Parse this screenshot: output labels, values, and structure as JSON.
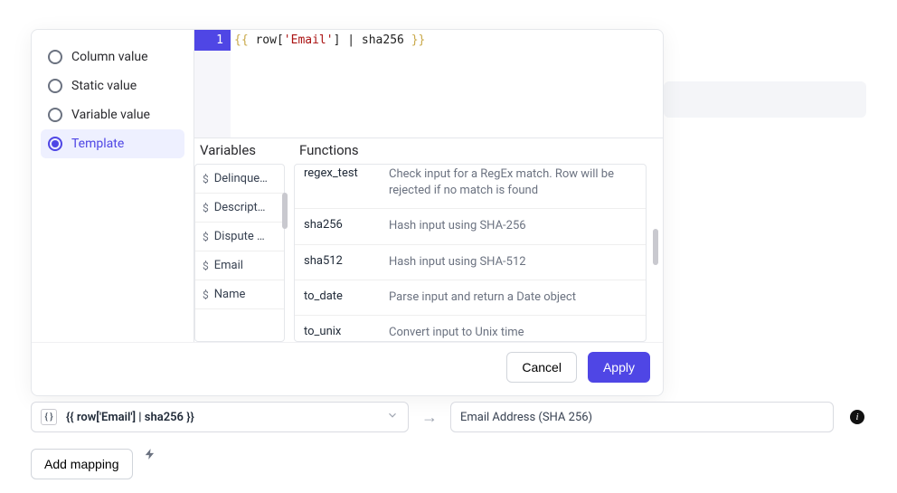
{
  "sidebar": {
    "options": [
      {
        "label": "Column value",
        "selected": false
      },
      {
        "label": "Static value",
        "selected": false
      },
      {
        "label": "Variable value",
        "selected": false
      },
      {
        "label": "Template",
        "selected": true
      }
    ]
  },
  "editor": {
    "line_no": "1",
    "open": "{{",
    "expr_p1": " row[",
    "expr_str": "'Email'",
    "expr_p2": "] | sha256 ",
    "close": "}}"
  },
  "helpers": {
    "vars_header": "Variables",
    "fns_header": "Functions",
    "vars": [
      "Delinque…",
      "Descript…",
      "Dispute …",
      "Email",
      "Name"
    ],
    "fns": [
      {
        "name": "regex_test",
        "desc": "Check input for a RegEx match. Row will be rejected if no match is found"
      },
      {
        "name": "sha256",
        "desc": "Hash input using SHA-256"
      },
      {
        "name": "sha512",
        "desc": "Hash input using SHA-512"
      },
      {
        "name": "to_date",
        "desc": "Parse input and return a Date object"
      },
      {
        "name": "to_unix",
        "desc": "Convert input to Unix time"
      }
    ]
  },
  "footer": {
    "cancel": "Cancel",
    "apply": "Apply"
  },
  "mapping": {
    "src_expr": "{{ row['Email'] | sha256 }}",
    "dst_label": "Email Address (SHA 256)",
    "add_label": "Add mapping"
  }
}
